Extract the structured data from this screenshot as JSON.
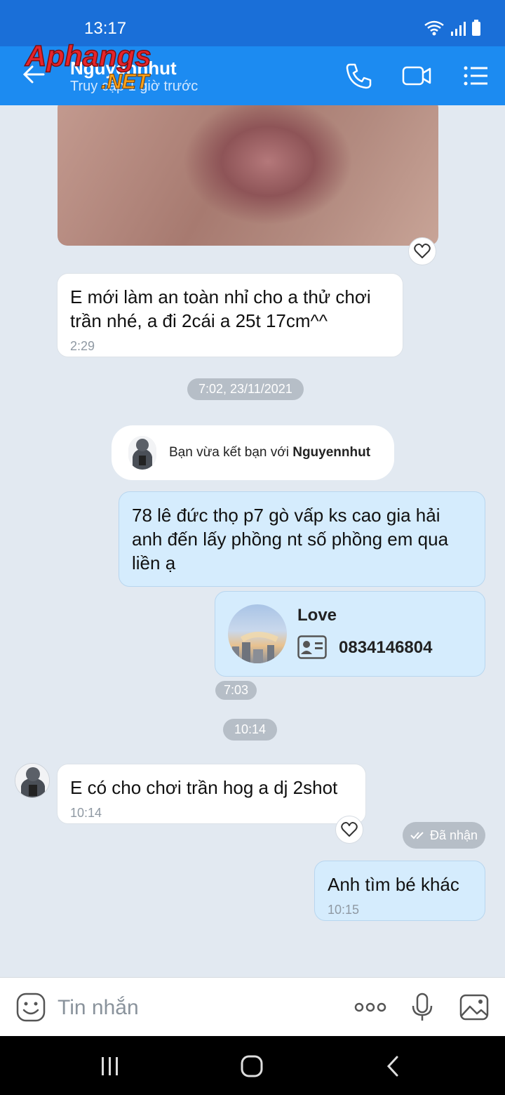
{
  "status_bar": {
    "time": "13:17"
  },
  "header": {
    "contact_name": "Nguyennhut",
    "contact_status": "Truy cập 1 giờ trước",
    "watermark_text": "Aphangs .NET"
  },
  "messages": [
    {
      "text": "E mới làm an toàn nhỉ cho a thử chơi trần nhé, a đi 2cái a 25t 17cm^^",
      "time": "2:29",
      "direction": "in"
    },
    {
      "text": "78 lê đức thọ p7 gò vấp ks cao gia hải anh đến lấy phồng nt số phồng em qua liền ạ",
      "direction": "out"
    },
    {
      "text": "E có cho chơi trần hog a dj 2shot",
      "time": "10:14",
      "direction": "in"
    },
    {
      "text": "Anh tìm bé khác",
      "time": "10:15",
      "direction": "out"
    }
  ],
  "date_separators": [
    "7:02, 23/11/2021",
    "10:14"
  ],
  "friend_notice": {
    "prefix": "Bạn vừa kết bạn với ",
    "name": "Nguyennhut"
  },
  "contact_card": {
    "name": "Love",
    "phone": "0834146804",
    "time": "7:03"
  },
  "delivery_status": "Đã nhận",
  "input": {
    "placeholder": "Tin nhắn"
  },
  "icons": [
    "back-arrow-icon",
    "phone-icon",
    "video-call-icon",
    "menu-icon",
    "heart-icon",
    "emoji-icon",
    "more-icon",
    "mic-icon",
    "image-icon",
    "contact-card-icon",
    "double-check-icon"
  ],
  "colors": {
    "header": "#1c8bf1",
    "status_bar": "#1a6fd8",
    "chat_bg": "#e2e9f1",
    "outgoing_bubble": "#d5ecfd",
    "incoming_bubble": "#ffffff"
  }
}
